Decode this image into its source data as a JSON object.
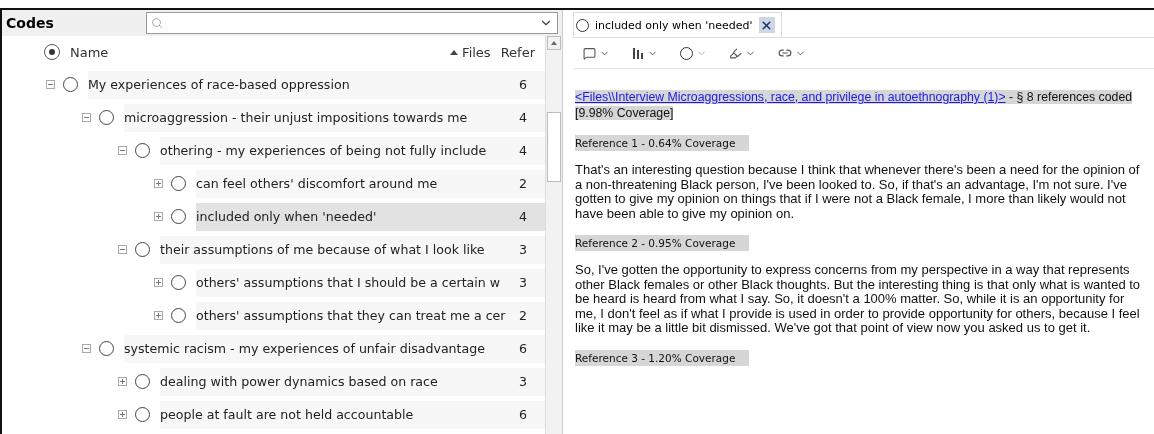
{
  "codes_panel": {
    "title": "Codes",
    "columns": [
      {
        "label": "Name"
      },
      {
        "label": "Files",
        "sorted": true
      },
      {
        "label": "Refer"
      }
    ],
    "tree": [
      {
        "label": "My experiences of race-based oppression",
        "refs": "6",
        "expanded": true,
        "selected": false,
        "children": [
          {
            "label": "microaggression - their unjust impositions towards me",
            "refs": "4",
            "expanded": true,
            "selected": false,
            "children": [
              {
                "label": "othering - my experiences of being not fully include",
                "refs": "4",
                "expanded": true,
                "selected": false,
                "children": [
                  {
                    "label": "can feel others' discomfort around me",
                    "refs": "2",
                    "expanded": false,
                    "selected": false
                  },
                  {
                    "label": "included only when 'needed'",
                    "refs": "4",
                    "expanded": false,
                    "selected": true
                  }
                ]
              },
              {
                "label": "their assumptions of me because of what I look like",
                "refs": "3",
                "expanded": true,
                "selected": false,
                "children": [
                  {
                    "label": "others' assumptions that I should be a certain w",
                    "refs": "3",
                    "expanded": false,
                    "selected": false
                  },
                  {
                    "label": "others' assumptions that they can treat me a cer",
                    "refs": "2",
                    "expanded": false,
                    "selected": false
                  }
                ]
              }
            ]
          },
          {
            "label": "systemic racism - my experiences of unfair disadvantage",
            "refs": "6",
            "expanded": true,
            "selected": false,
            "children": [
              {
                "label": "dealing with power dynamics based on race",
                "refs": "3",
                "expanded": false,
                "selected": false
              },
              {
                "label": "people at fault are not held accountable",
                "refs": "6",
                "expanded": false,
                "selected": false
              }
            ]
          }
        ]
      }
    ]
  },
  "detail_panel": {
    "tab": {
      "label": "included only when 'needed'",
      "selected": true
    },
    "source_link": "<Files\\\\Interview Microaggressions, race, and privilege in autoethnography (1)>",
    "source_summary": " - § 8 references coded",
    "coverage": "[9.98% Coverage]",
    "references": [
      {
        "heading": "Reference 1 - 0.64% Coverage",
        "text": "That's an interesting question because I think that whenever there's been a need for the opinion of a non-threatening Black person, I've been looked to. So, if that's an advantage, I'm not sure. I've gotten to give my opinion on things that if I were not a Black female, I more than likely would not have been able to give my opinion on."
      },
      {
        "heading": "Reference 2 - 0.95% Coverage",
        "text": "So, I've gotten the opportunity to express concerns from my perspective in a way that represents other Black females or other Black thoughts. But the interesting thing is that only what is wanted to be heard is heard from what I say. So, it doesn't a 100% matter. So, while it is an opportunity for me, I don't feel as if what I provide is used in order to provide opportunity for others, because I feel like it may be a little bit dismissed. We've got that point of view now you asked us to get it."
      },
      {
        "heading": "Reference 3 - 1.20% Coverage"
      }
    ]
  }
}
